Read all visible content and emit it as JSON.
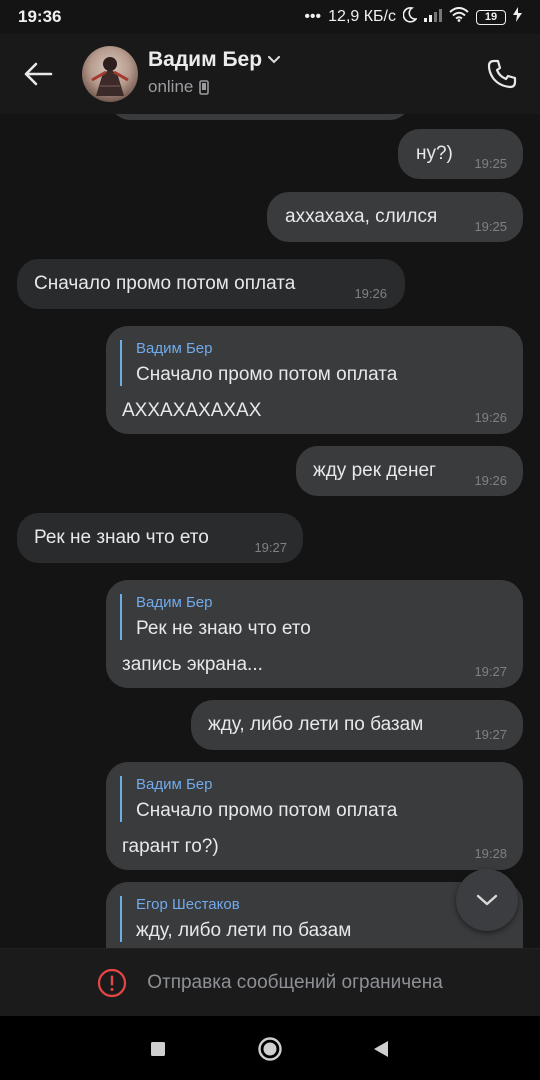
{
  "status_bar": {
    "time": "19:36",
    "speed": "12,9 КБ/с",
    "battery": "19"
  },
  "header": {
    "contact_name": "Вадим Бер",
    "status": "online"
  },
  "messages": [
    {
      "type": "outgoing",
      "text": "ну?)",
      "time": "19:25"
    },
    {
      "type": "outgoing",
      "text": "аххахаха, слился",
      "time": "19:25"
    },
    {
      "type": "incoming",
      "text": "Сначало промо потом оплата",
      "time": "19:26"
    },
    {
      "type": "outgoing",
      "reply_author": "Вадим Бер",
      "reply_text": "Сначало промо потом оплата",
      "text": "АХХАХАХАХАХ",
      "time": "19:26"
    },
    {
      "type": "outgoing",
      "text": "жду рек денег",
      "time": "19:26"
    },
    {
      "type": "incoming",
      "text": "Рек не знаю что ето",
      "time": "19:27"
    },
    {
      "type": "outgoing",
      "reply_author": "Вадим Бер",
      "reply_text": "Рек не знаю что ето",
      "text": "запись экрана...",
      "time": "19:27"
    },
    {
      "type": "outgoing",
      "text": "жду, либо лети по базам",
      "time": "19:27"
    },
    {
      "type": "outgoing",
      "reply_author": "Вадим Бер",
      "reply_text": "Сначало промо потом оплата",
      "text": "гарант го?)",
      "time": "19:28"
    },
    {
      "type": "outgoing",
      "reply_author": "Егор Шестаков",
      "reply_text": "жду, либо лети по базам",
      "text": "",
      "time": ""
    }
  ],
  "restriction": {
    "text": "Отправка сообщений ограничена"
  },
  "colors": {
    "accent": "#71aaeb",
    "outgoing_bubble": "#3a3b3d",
    "incoming_bubble": "#2a2b2d",
    "warning": "#e64646"
  },
  "icons": {
    "back": "arrow-left-icon",
    "call": "phone-icon",
    "scroll_down": "chevron-down-icon",
    "warning": "alert-circle-icon"
  }
}
